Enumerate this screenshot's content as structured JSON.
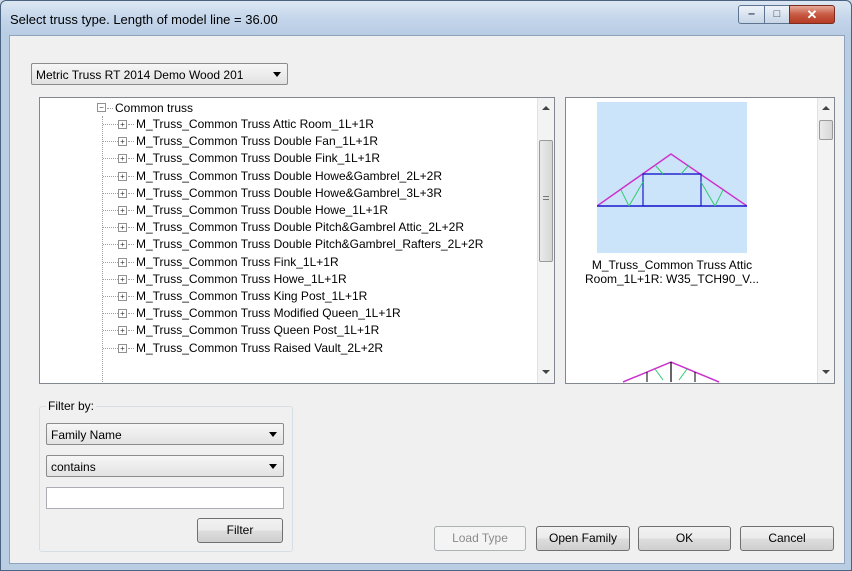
{
  "window": {
    "title": "Select truss type. Length of model line = 36.00",
    "minimize_glyph": "‒",
    "maximize_glyph": "□",
    "close_glyph": "✕"
  },
  "library_select": {
    "value": "Metric Truss RT 2014 Demo Wood 201"
  },
  "tree": {
    "root": {
      "label": "Common truss",
      "expander": "−"
    },
    "collapsed_expander": "+",
    "items": [
      "M_Truss_Common Truss Attic Room_1L+1R",
      "M_Truss_Common Truss Double Fan_1L+1R",
      "M_Truss_Common Truss Double Fink_1L+1R",
      "M_Truss_Common Truss Double Howe&Gambrel_2L+2R",
      "M_Truss_Common Truss Double Howe&Gambrel_3L+3R",
      "M_Truss_Common Truss Double Howe_1L+1R",
      "M_Truss_Common Truss Double Pitch&Gambrel Attic_2L+2R",
      "M_Truss_Common Truss Double Pitch&Gambrel_Rafters_2L+2R",
      "M_Truss_Common Truss Fink_1L+1R",
      "M_Truss_Common Truss Howe_1L+1R",
      "M_Truss_Common Truss King Post_1L+1R",
      "M_Truss_Common Truss Modified Queen_1L+1R",
      "M_Truss_Common Truss Queen Post_1L+1R",
      "M_Truss_Common Truss Raised Vault_2L+2R"
    ]
  },
  "preview": {
    "selected_caption_line1": "M_Truss_Common Truss Attic",
    "selected_caption_line2": "Room_1L+1R: W35_TCH90_V...",
    "selection_color": "#cce4fa",
    "chord_color": "#1a1acc",
    "top_chord_color": "#cc33cc",
    "web_color": "#2ecc71"
  },
  "filter": {
    "group_label": "Filter by:",
    "field_value": "Family Name",
    "operator_value": "contains",
    "text_value": "",
    "filter_button": "Filter"
  },
  "buttons": {
    "load_type": "Load Type",
    "open_family": "Open Family",
    "ok": "OK",
    "cancel": "Cancel"
  }
}
